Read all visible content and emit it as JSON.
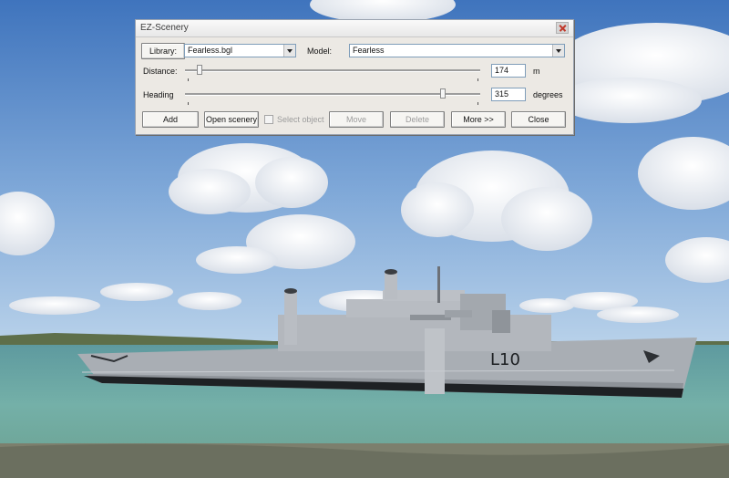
{
  "dialog": {
    "title": "EZ-Scenery",
    "library_button": "Library:",
    "library_value": "Fearless.bgl",
    "model_label": "Model:",
    "model_value": "Fearless",
    "distance_label": "Distance:",
    "distance_value": "174",
    "distance_unit": "m",
    "distance_slider_fraction": 0.04,
    "heading_label": "Heading",
    "heading_value": "315",
    "heading_unit": "degrees",
    "heading_slider_fraction": 0.88,
    "buttons": {
      "add": "Add",
      "open_scenery": "Open scenery",
      "select_object": "Select object",
      "move": "Move",
      "delete": "Delete",
      "more": "More >>",
      "close": "Close"
    }
  },
  "scene": {
    "ship_hull_number": "L10",
    "sky_color": "#4a7ec2",
    "sea_color": "#6aa7a2",
    "ship_color": "#a8adb3"
  }
}
